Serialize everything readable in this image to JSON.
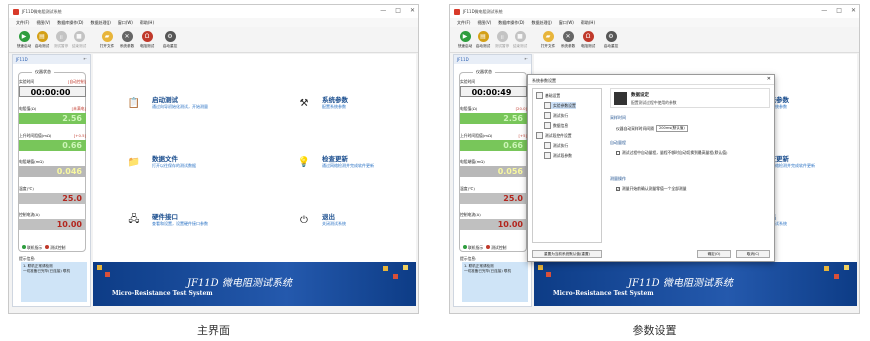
{
  "window": {
    "title": "JF11D微电阻测试系统",
    "controls": [
      "—",
      "□",
      "✕"
    ]
  },
  "menu": [
    "文件(F)",
    "视图(V)",
    "数据库操作(D)",
    "数据处理(J)",
    "窗口(W)",
    "帮助(H)"
  ],
  "toolbar": [
    {
      "label": "快速启动",
      "icon": "play-icon",
      "color": "#2e9d3e",
      "glyph": "▶",
      "enabled": true
    },
    {
      "label": "启动测试",
      "icon": "clipboard-icon",
      "color": "#d4a017",
      "glyph": "▤",
      "enabled": true
    },
    {
      "label": "测试暂停",
      "icon": "pause-icon",
      "color": "#888888",
      "glyph": "॥",
      "enabled": false
    },
    {
      "label": "结束测试",
      "icon": "stop-icon",
      "color": "#888888",
      "glyph": "■",
      "enabled": false
    },
    {
      "label": "打开文件",
      "icon": "folder-icon",
      "color": "#e8b53b",
      "glyph": "▰",
      "enabled": true
    },
    {
      "label": "系统参数",
      "icon": "tools-icon",
      "color": "#666666",
      "glyph": "✕",
      "enabled": true
    },
    {
      "label": "电阻测试",
      "icon": "omega-icon",
      "color": "#c0392b",
      "glyph": "Ω",
      "enabled": true
    },
    {
      "label": "启动重控",
      "icon": "gear-icon",
      "color": "#555555",
      "glyph": "⚙",
      "enabled": true
    }
  ],
  "panel": {
    "title": "JF11D",
    "monitor_label": "仪器状态",
    "fields": [
      {
        "label": "实验时间",
        "tag": "[自动控制]",
        "value": "00:00:00",
        "style": "v-time"
      },
      {
        "label": "电阻值(Ω)",
        "tag": "[未满电]",
        "value": "2.56",
        "style": "v-green"
      },
      {
        "label": "上升时间阻值(mΩ)",
        "tag": "[+0.5]",
        "value": "0.66",
        "style": "v-green"
      },
      {
        "label": "电阻端值(mΩ)",
        "tag": "",
        "value": "0.046",
        "style": "v-gray"
      },
      {
        "label": "温度(℃)",
        "tag": "",
        "value": "25.0",
        "style": "v-red"
      },
      {
        "label": "控制电流(A)",
        "tag": "",
        "value": "10.00",
        "style": "v-red"
      }
    ],
    "lights": [
      {
        "label": "联机指示",
        "color": "#2e9d3e"
      },
      {
        "label": "测试控制",
        "color": "#c0392b"
      }
    ],
    "tips_title": "提示信息:",
    "tips_lines": [
      "1. 联机正常请检测",
      "  一切准备已完毕(已连接) 联机"
    ]
  },
  "features": [
    {
      "title": "启动测试",
      "desc": "通过向导初始化测试，开始测量",
      "icon": "clipboard-icon",
      "glyph": "📋"
    },
    {
      "title": "系统参数",
      "desc": "配置系统参数",
      "icon": "tools-icon",
      "glyph": "⚒"
    },
    {
      "title": "数据文件",
      "desc": "打开以往保存的测试数据",
      "icon": "folder-icon",
      "glyph": "📁"
    },
    {
      "title": "检查更新",
      "desc": "通过网络检测并完成软件更新",
      "icon": "bulb-icon",
      "glyph": "💡"
    },
    {
      "title": "硬件接口",
      "desc": "查看和设置，设置硬件接口参数",
      "icon": "hardware-icon",
      "glyph": "🖧"
    },
    {
      "title": "退出",
      "desc": "关闭测试系统",
      "icon": "power-icon",
      "glyph": "⏻"
    }
  ],
  "banner": {
    "title": "JF11D 微电阻测试系统",
    "subtitle": "Micro-Resistance  Test System"
  },
  "dialog": {
    "title": "系统参数设置",
    "tree": [
      {
        "label": "基础设置",
        "level": 0
      },
      {
        "label": "实验参数设置",
        "level": 1,
        "selected": true
      },
      {
        "label": "测试执行",
        "level": 1
      },
      {
        "label": "数据信息",
        "level": 1
      },
      {
        "label": "测试段控件设置",
        "level": 0
      },
      {
        "label": "测试执行",
        "level": 1
      },
      {
        "label": "测试段参数",
        "level": 1
      }
    ],
    "head_title": "数据设定",
    "head_desc": "配置测试过程中使用的参数",
    "sec1": "采样时间",
    "opt1_label": "仪器自动采样时间间隔",
    "opt1_value": "200ms(默认值)",
    "sec2": "自动量程",
    "opt2": "测试过程中自动量程，量程不够时自动切换到最高量程(默认值)",
    "sec3": "测量操作",
    "opt3": "测量开始前确认测量零值一个全部测量",
    "reset_btn": "重置为当前系统默认值(重置)",
    "ok": "确定(O)",
    "cancel": "取消(C)"
  },
  "panelB": {
    "fields": [
      {
        "label": "实验时间",
        "tag": "",
        "value": "00:00:49",
        "style": "v-time"
      },
      {
        "label": "电阻值(Ω)",
        "tag": "[20.0]",
        "value": "2.56",
        "style": "v-green"
      },
      {
        "label": "上升时间阻值(mΩ)",
        "tag": "[+5]",
        "value": "0.66",
        "style": "v-green"
      },
      {
        "label": "电阻端值(mΩ)",
        "tag": "",
        "value": "0.056",
        "style": "v-gray"
      },
      {
        "label": "温度(℃)",
        "tag": "",
        "value": "25.0",
        "style": "v-red"
      },
      {
        "label": "控制电流(A)",
        "tag": "",
        "value": "10.00",
        "style": "v-red"
      }
    ],
    "tips_lines": [
      "1. 联机正常请检测",
      "  一切准备已完毕(已连接) 联机"
    ]
  },
  "captions": [
    "主界面",
    "参数设置"
  ]
}
